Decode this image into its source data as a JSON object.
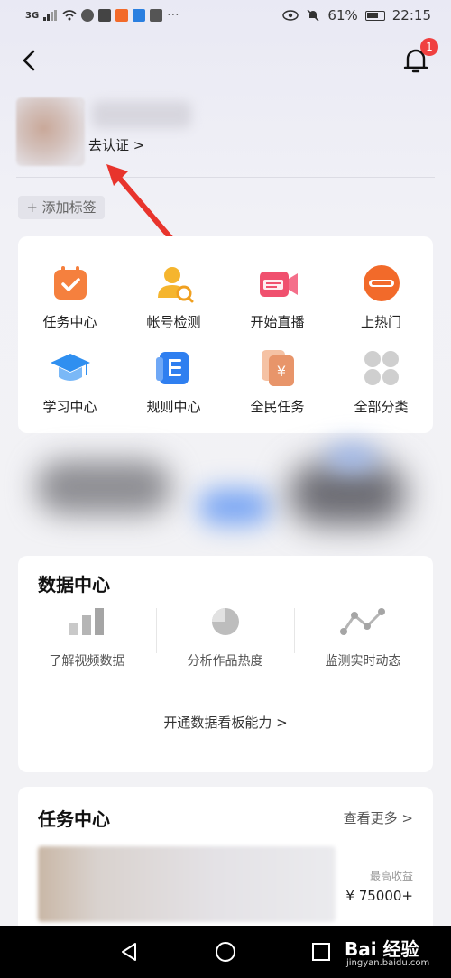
{
  "status_bar": {
    "network": "3G",
    "battery": "61%",
    "time": "22:15"
  },
  "header": {
    "notification_count": "1"
  },
  "profile": {
    "verify_link": "去认证 >",
    "add_tag": "+ 添加标签"
  },
  "grid": {
    "items": [
      {
        "label": "任务中心",
        "icon": "task-calendar-icon",
        "color": "#f5803e"
      },
      {
        "label": "帐号检测",
        "icon": "account-check-icon",
        "color": "#f5b52e"
      },
      {
        "label": "开始直播",
        "icon": "live-camera-icon",
        "color": "#f0506e"
      },
      {
        "label": "上热门",
        "icon": "dou-plus-icon",
        "color": "#f26a2a"
      },
      {
        "label": "学习中心",
        "icon": "graduation-cap-icon",
        "color": "#2f8ff0"
      },
      {
        "label": "规则中心",
        "icon": "rules-book-icon",
        "color": "#2f7ff0"
      },
      {
        "label": "全民任务",
        "icon": "money-card-icon",
        "color": "#e8956a"
      },
      {
        "label": "全部分类",
        "icon": "all-categories-icon",
        "color": "#c8c8c8"
      }
    ]
  },
  "data_center": {
    "title": "数据中心",
    "items": [
      {
        "label": "了解视频数据",
        "icon": "bar-chart-icon"
      },
      {
        "label": "分析作品热度",
        "icon": "pie-chart-icon"
      },
      {
        "label": "监测实时动态",
        "icon": "line-trend-icon"
      }
    ],
    "open_link": "开通数据看板能力 >"
  },
  "task_center": {
    "title": "任务中心",
    "more_link": "查看更多 >",
    "income_label": "最高收益",
    "income_value": "¥ 75000+"
  },
  "watermark": {
    "brand": "Bai 经验",
    "url": "jingyan.baidu.com"
  }
}
